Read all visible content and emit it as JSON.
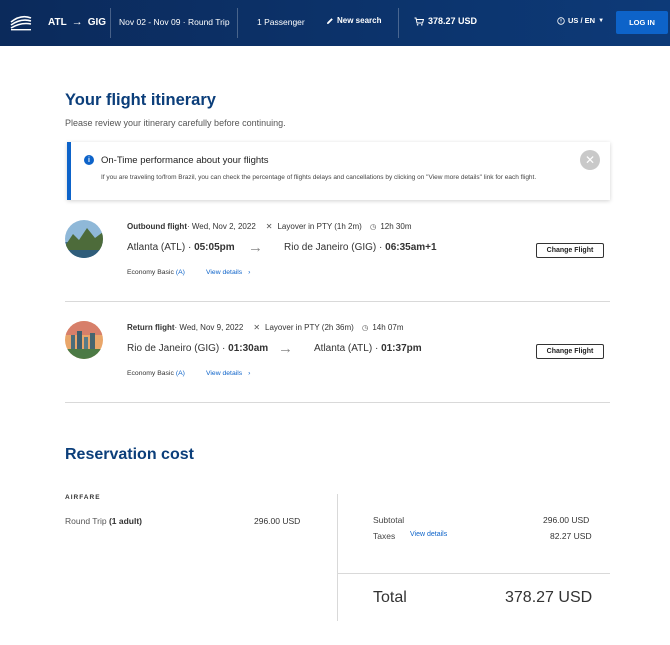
{
  "header": {
    "origin": "ATL",
    "destination": "GIG",
    "dates": "Nov 02 - Nov 09 · Round Trip",
    "passengers": "1 Passenger",
    "new_search": "New search",
    "cart_total": "378.27 USD",
    "language": "US / EN",
    "login": "LOG IN"
  },
  "itinerary": {
    "title": "Your flight itinerary",
    "subtitle": "Please review your itinerary carefully before continuing."
  },
  "banner": {
    "title": "On-Time performance about your flights",
    "text": "If you are traveling to/from Brazil, you can check the percentage of flights delays and cancellations by clicking on \"View more details\" link for each flight."
  },
  "flights": [
    {
      "label": "Outbound flight",
      "date": " · Wed, Nov 2, 2022",
      "layover": "Layover in PTY (1h 2m)",
      "duration": "12h 30m",
      "from_city": "Atlanta (ATL) · ",
      "from_time": "05:05pm",
      "to_city": "Rio de Janeiro (GIG) · ",
      "to_time": "06:35am+1",
      "fare": "Economy Basic",
      "fare_code": "(A)",
      "details": "View details",
      "change": "Change Flight"
    },
    {
      "label": "Return flight",
      "date": " · Wed, Nov 9, 2022",
      "layover": "Layover in PTY (2h 36m)",
      "duration": "14h 07m",
      "from_city": "Rio de Janeiro (GIG) · ",
      "from_time": "01:30am",
      "to_city": "Atlanta (ATL) · ",
      "to_time": "01:37pm",
      "fare": "Economy Basic",
      "fare_code": "(A)",
      "details": "View details",
      "change": "Change Flight"
    }
  ],
  "cost": {
    "title": "Reservation cost",
    "airfare_label": "AIRFARE",
    "round_trip": "Round Trip ",
    "adults": "(1 adult)",
    "round_trip_value": "296.00 USD",
    "subtotal_label": "Subtotal",
    "subtotal_value": "296.00 USD",
    "taxes_label": "Taxes",
    "taxes_details": "View details",
    "taxes_value": "82.27 USD",
    "total_label": "Total",
    "total_value": "378.27 USD"
  },
  "colors": {
    "header_bg": "#0b2a5b",
    "accent": "#0d63c9",
    "title": "#0b3e7a"
  }
}
